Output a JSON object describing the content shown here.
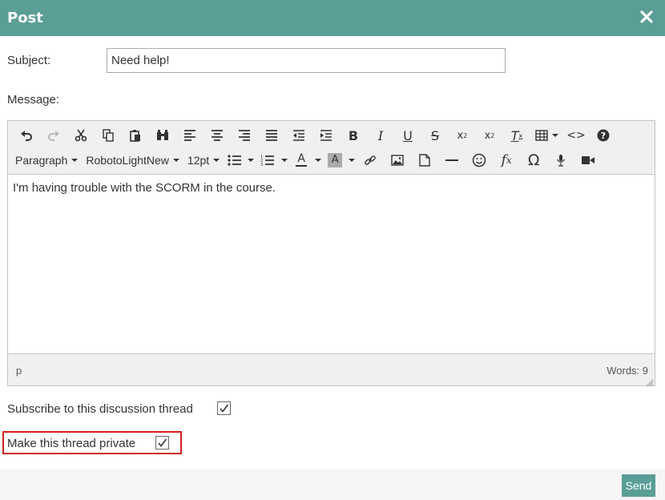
{
  "dialog": {
    "title": "Post"
  },
  "form": {
    "subject_label": "Subject:",
    "subject_value": "Need help!",
    "message_label": "Message:"
  },
  "editor": {
    "format_dropdown": "Paragraph",
    "font_dropdown": "RobotoLightNew",
    "size_dropdown": "12pt",
    "content_text": "I'm having trouble with the SCORM in the course.",
    "status_path": "p",
    "word_count": "Words: 9",
    "toolbar_row1_icons": [
      "undo-icon",
      "redo-icon",
      "cut-icon",
      "copy-icon",
      "paste-icon",
      "find-icon",
      "align-left-icon",
      "align-center-icon",
      "align-right-icon",
      "justify-icon",
      "outdent-icon",
      "indent-icon",
      "bold-icon",
      "italic-icon",
      "underline-icon",
      "strikethrough-icon",
      "subscript-icon",
      "superscript-icon",
      "clear-format-icon",
      "table-icon",
      "code-icon",
      "help-icon"
    ],
    "toolbar_row2_icons": [
      "bullet-list-icon",
      "numbered-list-icon",
      "text-color-icon",
      "background-color-icon",
      "link-icon",
      "image-icon",
      "document-icon",
      "horizontal-rule-icon",
      "emoticon-icon",
      "formula-icon",
      "special-char-icon",
      "audio-icon",
      "video-icon"
    ]
  },
  "options": {
    "subscribe_label": "Subscribe to this discussion thread",
    "subscribe_checked": true,
    "private_label": "Make this thread private",
    "private_checked": true
  },
  "footer": {
    "send_label": "Send"
  },
  "colors": {
    "header": "#5a9e96",
    "highlight": "#d32020"
  }
}
